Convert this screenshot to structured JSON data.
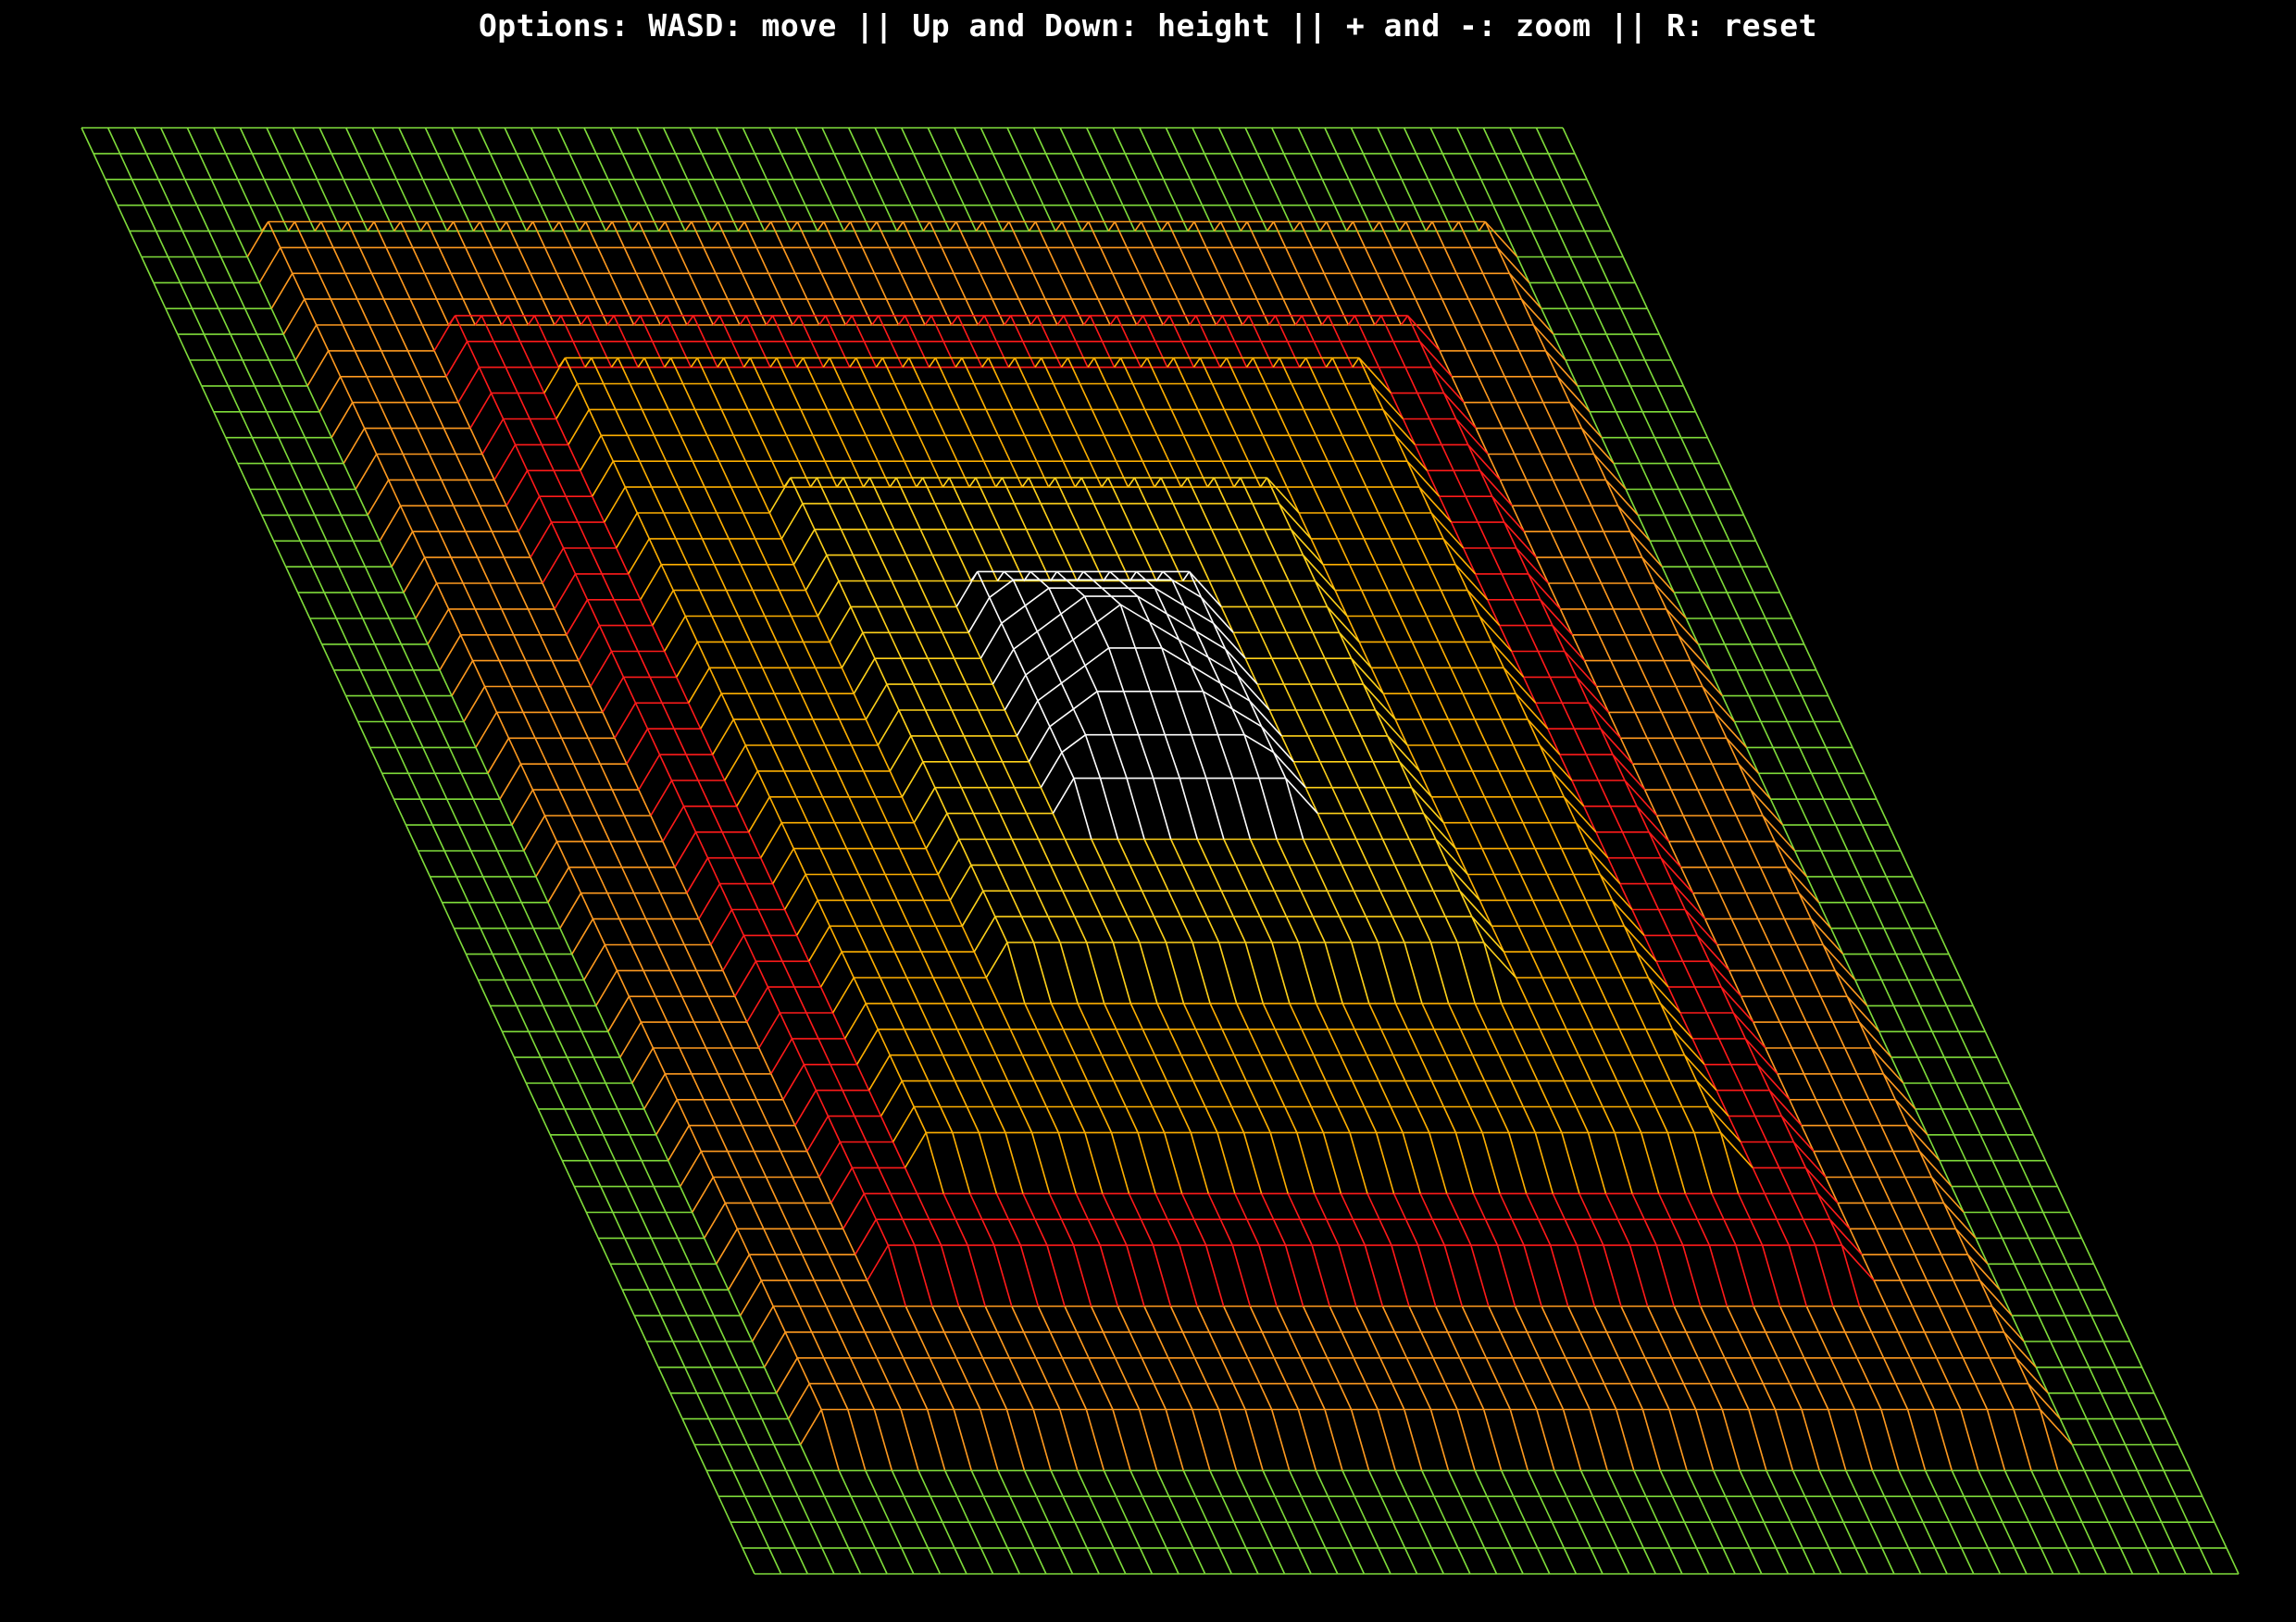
{
  "hud": {
    "options_text": "Options: WASD: move || Up and Down: height || + and -: zoom || R: reset"
  },
  "terrain": {
    "description_colors": {
      "background": "#000000",
      "outer_rim": "#7fdc3a",
      "upper_terrace": "#ff9a1f",
      "steep_wall": "#ff1a1a",
      "middle_terrace": "#ffc21a",
      "peak": "#ffffff"
    },
    "grid_resolution": 56,
    "levels": [
      {
        "name": "outer-rim",
        "ring_from": 0,
        "ring_to": 5,
        "height": 0,
        "color": "#7fdc3a"
      },
      {
        "name": "upper-terrace",
        "ring_from": 5,
        "ring_to": 10,
        "height": 1,
        "color": "#ff9a1f"
      },
      {
        "name": "steep-wall",
        "ring_from": 10,
        "ring_to": 13,
        "height": 2,
        "color": "#ff1a1a"
      },
      {
        "name": "middle-terrace",
        "ring_from": 13,
        "ring_to": 19,
        "height": 3,
        "color": "#ffb000"
      },
      {
        "name": "inner-terrace",
        "ring_from": 19,
        "ring_to": 24,
        "height": 4,
        "color": "#ffd21a"
      },
      {
        "name": "peak",
        "ring_from": 24,
        "ring_to": 28,
        "height": 5,
        "color": "#ffffff"
      }
    ]
  }
}
